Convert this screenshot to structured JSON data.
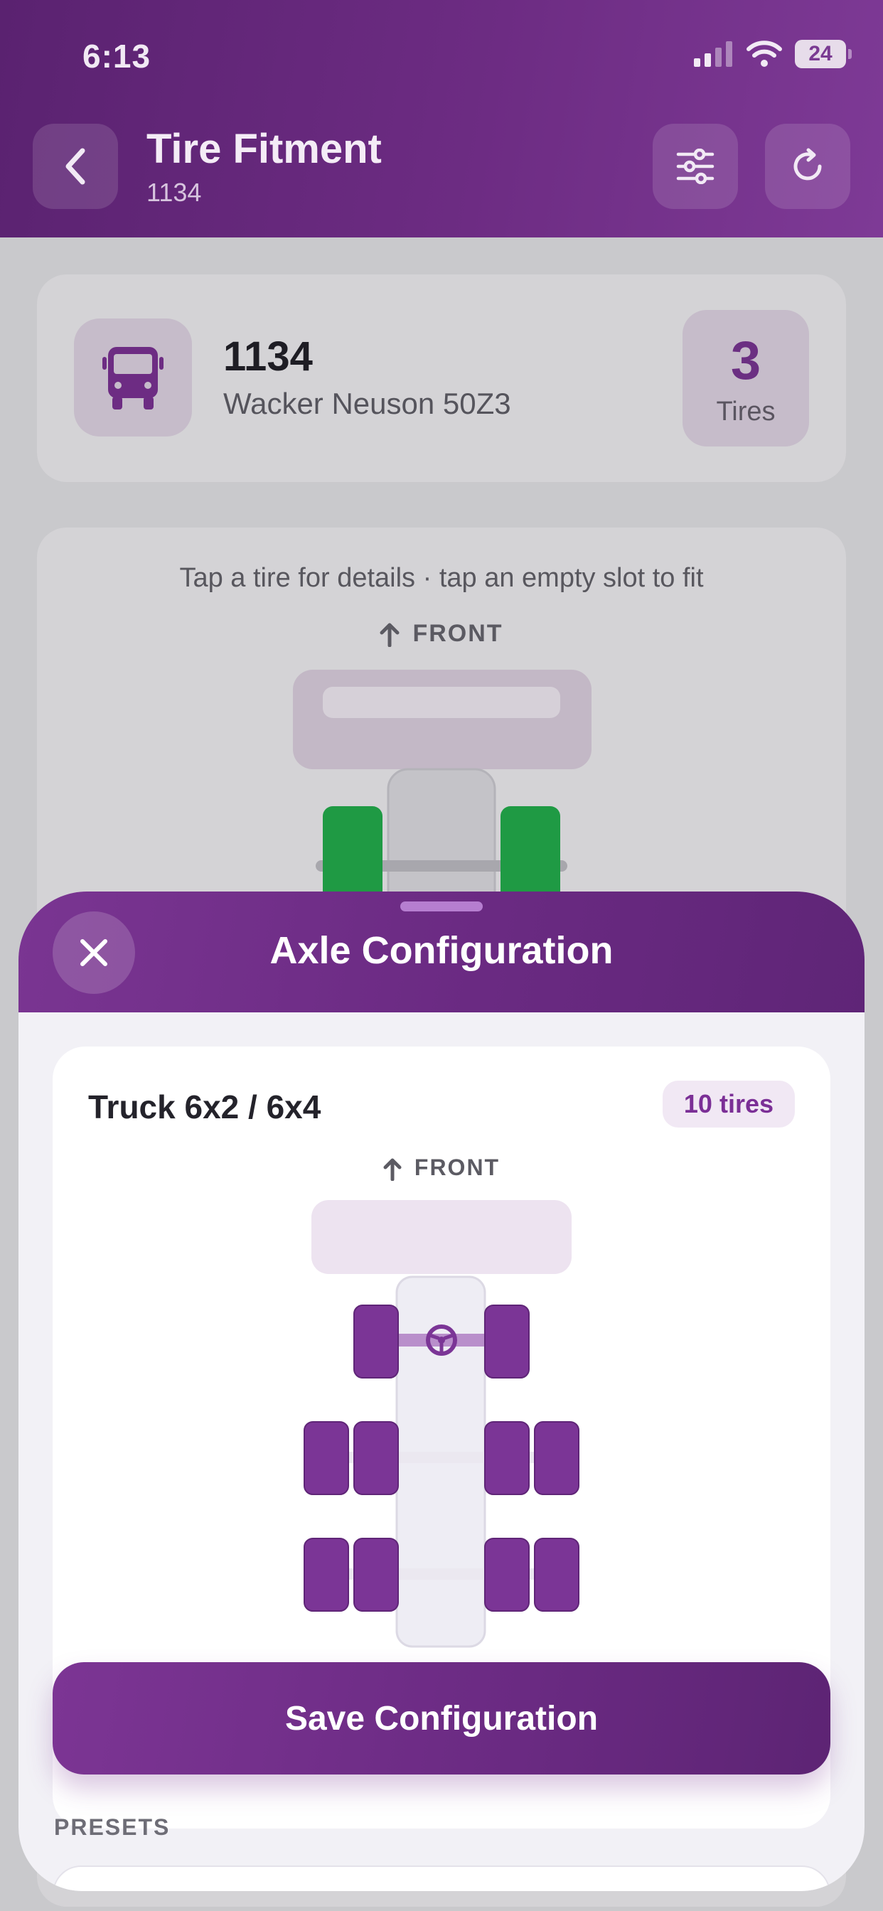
{
  "status_bar": {
    "time": "6:13",
    "battery": "24"
  },
  "header": {
    "title": "Tire Fitment",
    "subtitle": "1134"
  },
  "vehicle": {
    "id": "1134",
    "model": "Wacker Neuson 50Z3",
    "tire_count": "3",
    "tire_count_label": "Tires"
  },
  "map": {
    "hint": "Tap a tire for details · tap an empty slot to fit",
    "front_label": "FRONT"
  },
  "sheet": {
    "title": "Axle Configuration",
    "config_name": "Truck 6x2 / 6x4",
    "tire_badge": "10 tires",
    "front_label": "FRONT",
    "save_label": "Save Configuration",
    "presets_label": "PRESETS"
  },
  "colors": {
    "brand_purple": "#6d2c83",
    "tire_purple": "#7b3596",
    "fitted_tire_green": "#1f9a44"
  }
}
